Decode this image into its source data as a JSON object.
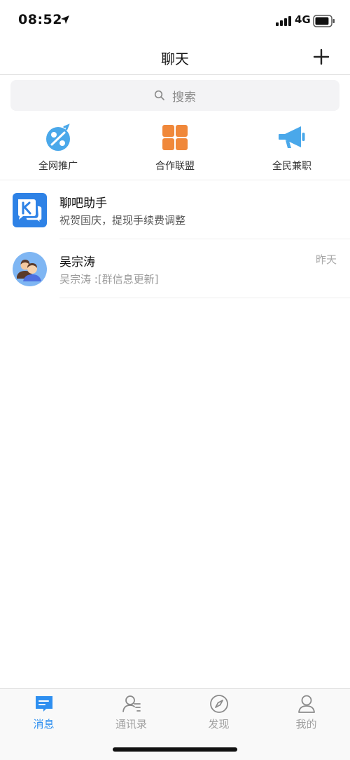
{
  "status_bar": {
    "time": "08:52",
    "network": "4G",
    "location_icon": "location-arrow-icon",
    "signal_icon": "cellular-signal-icon",
    "battery_icon": "battery-icon",
    "battery_level": 0.9
  },
  "nav": {
    "title": "聊天",
    "add_icon": "plus-icon"
  },
  "search": {
    "placeholder": "搜索",
    "icon": "search-icon"
  },
  "shortcuts": [
    {
      "label": "全网推广",
      "icon": "promotion-percent-icon",
      "color": "#4aa8ea"
    },
    {
      "label": "合作联盟",
      "icon": "grid-tiles-icon",
      "color": "#f0883a"
    },
    {
      "label": "全民兼职",
      "icon": "megaphone-icon",
      "color": "#4aa8ea"
    }
  ],
  "chats": [
    {
      "name": "聊吧助手",
      "preview": "祝贺国庆，提现手续费调整",
      "time": "",
      "avatar_icon": "app-k-logo-icon"
    },
    {
      "name": "吴宗涛",
      "preview": "吴宗涛 :[群信息更新]",
      "time": "昨天",
      "avatar_icon": "group-avatar-icon"
    }
  ],
  "tabs": [
    {
      "label": "消息",
      "icon": "message-icon",
      "active": true
    },
    {
      "label": "通讯录",
      "icon": "contacts-icon",
      "active": false
    },
    {
      "label": "发现",
      "icon": "compass-icon",
      "active": false
    },
    {
      "label": "我的",
      "icon": "profile-icon",
      "active": false
    }
  ],
  "colors": {
    "accent": "#2e8ff0",
    "inactive_tab": "#a0a0a0",
    "shortcut_blue": "#4aa8ea",
    "shortcut_orange": "#f0883a"
  }
}
